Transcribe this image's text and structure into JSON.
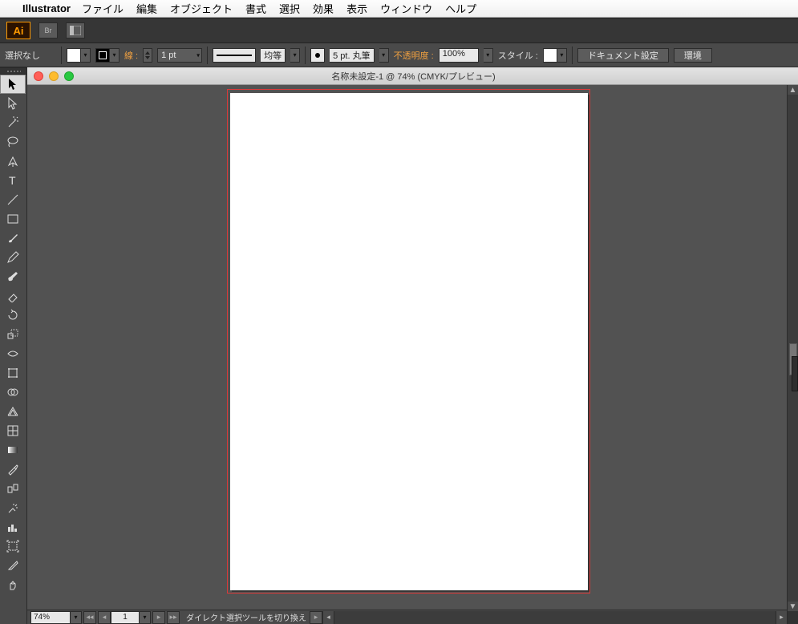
{
  "menubar": {
    "app": "Illustrator",
    "items": [
      "ファイル",
      "編集",
      "オブジェクト",
      "書式",
      "選択",
      "効果",
      "表示",
      "ウィンドウ",
      "ヘルプ"
    ]
  },
  "appheader": {
    "logo": "Ai",
    "br": "Br"
  },
  "options": {
    "selection": "選択なし",
    "stroke_label": "線 :",
    "stroke_weight": "1 pt",
    "profile_label": "均等",
    "brush_label": "5 pt. 丸筆",
    "opacity_label": "不透明度 :",
    "opacity_value": "100%",
    "style_label": "スタイル :",
    "docsetup": "ドキュメント設定",
    "prefs": "環境"
  },
  "document": {
    "title": "名称未設定-1 @ 74% (CMYK/プレビュー)"
  },
  "status": {
    "zoom": "74%",
    "page": "1",
    "tool_hint": "ダイレクト選択ツールを切り換え"
  },
  "tools": [
    "selection-tool",
    "direct-selection-tool",
    "magic-wand-tool",
    "lasso-tool",
    "pen-tool",
    "type-tool",
    "line-tool",
    "rectangle-tool",
    "paintbrush-tool",
    "pencil-tool",
    "blob-brush-tool",
    "eraser-tool",
    "rotate-tool",
    "scale-tool",
    "width-tool",
    "free-transform-tool",
    "shape-builder-tool",
    "perspective-grid-tool",
    "mesh-tool",
    "gradient-tool",
    "eyedropper-tool",
    "blend-tool",
    "symbol-sprayer-tool",
    "column-graph-tool",
    "artboard-tool",
    "slice-tool",
    "hand-tool"
  ]
}
